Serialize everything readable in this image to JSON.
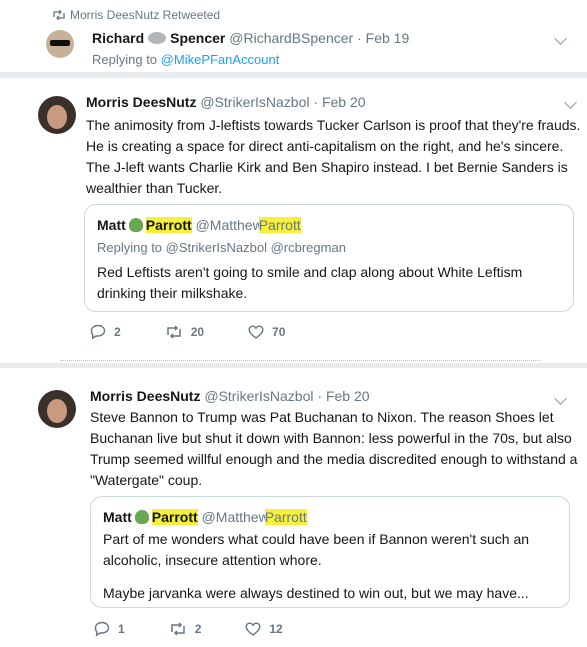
{
  "retweet": {
    "retweeted_label": "Morris DeesNutz Retweeted",
    "author_first": "Richard",
    "author_last": "Spencer",
    "handle": "@RichardBSpencer",
    "date": "· Feb 19",
    "replying_prefix": "Replying to",
    "replying_to": "@MikePFanAccount"
  },
  "tweet1": {
    "author": "Morris DeesNutz",
    "handle": "@StrikerIsNazbol",
    "date": "· Feb 20",
    "lines": [
      "The animosity from J-leftists towards Tucker Carlson is proof that they're frauds.",
      "He is creating a space for direct anti-capitalism on the right, and he's sincere.",
      "The J-left wants Charlie Kirk and Ben Shapiro instead.  I bet Bernie Sanders is",
      "wealthier than Tucker."
    ],
    "quote": {
      "author_first": "Matt",
      "author_last": "Parrott",
      "handle_prefix": "@Matthew",
      "handle_highlight": "Parrott",
      "replying": "Replying to @StrikerIsNazbol @rcbregman",
      "lines": [
        "Red Leftists aren't going to smile and clap along about White Leftism",
        "drinking their milkshake."
      ]
    },
    "replies": "2",
    "retweets": "20",
    "likes": "70"
  },
  "tweet2": {
    "author": "Morris DeesNutz",
    "handle": "@StrikerIsNazbol",
    "date": "· Feb 20",
    "lines": [
      "Steve Bannon to Trump was Pat Buchanan to Nixon. The reason Shoes let",
      "Buchanan live but shut it down with Bannon: less powerful in the 70s,  but also",
      "Trump seemed willful enough and the media discredited enough to  withstand a",
      "\"Watergate\" coup."
    ],
    "quote": {
      "author_first": "Matt",
      "author_last": "Parrott",
      "handle_prefix": "@Matthew",
      "handle_highlight": "Parrott",
      "lines": [
        "Part of me wonders what could have been if Bannon weren't such an",
        "alcoholic, insecure attention whore."
      ],
      "line_after": "Maybe jarvanka were always destined to win out, but we may have..."
    },
    "replies": "1",
    "retweets": "2",
    "likes": "12"
  },
  "colors": {
    "link": "#1da1f2",
    "muted": "#657786",
    "highlight": "#f6f03a"
  }
}
